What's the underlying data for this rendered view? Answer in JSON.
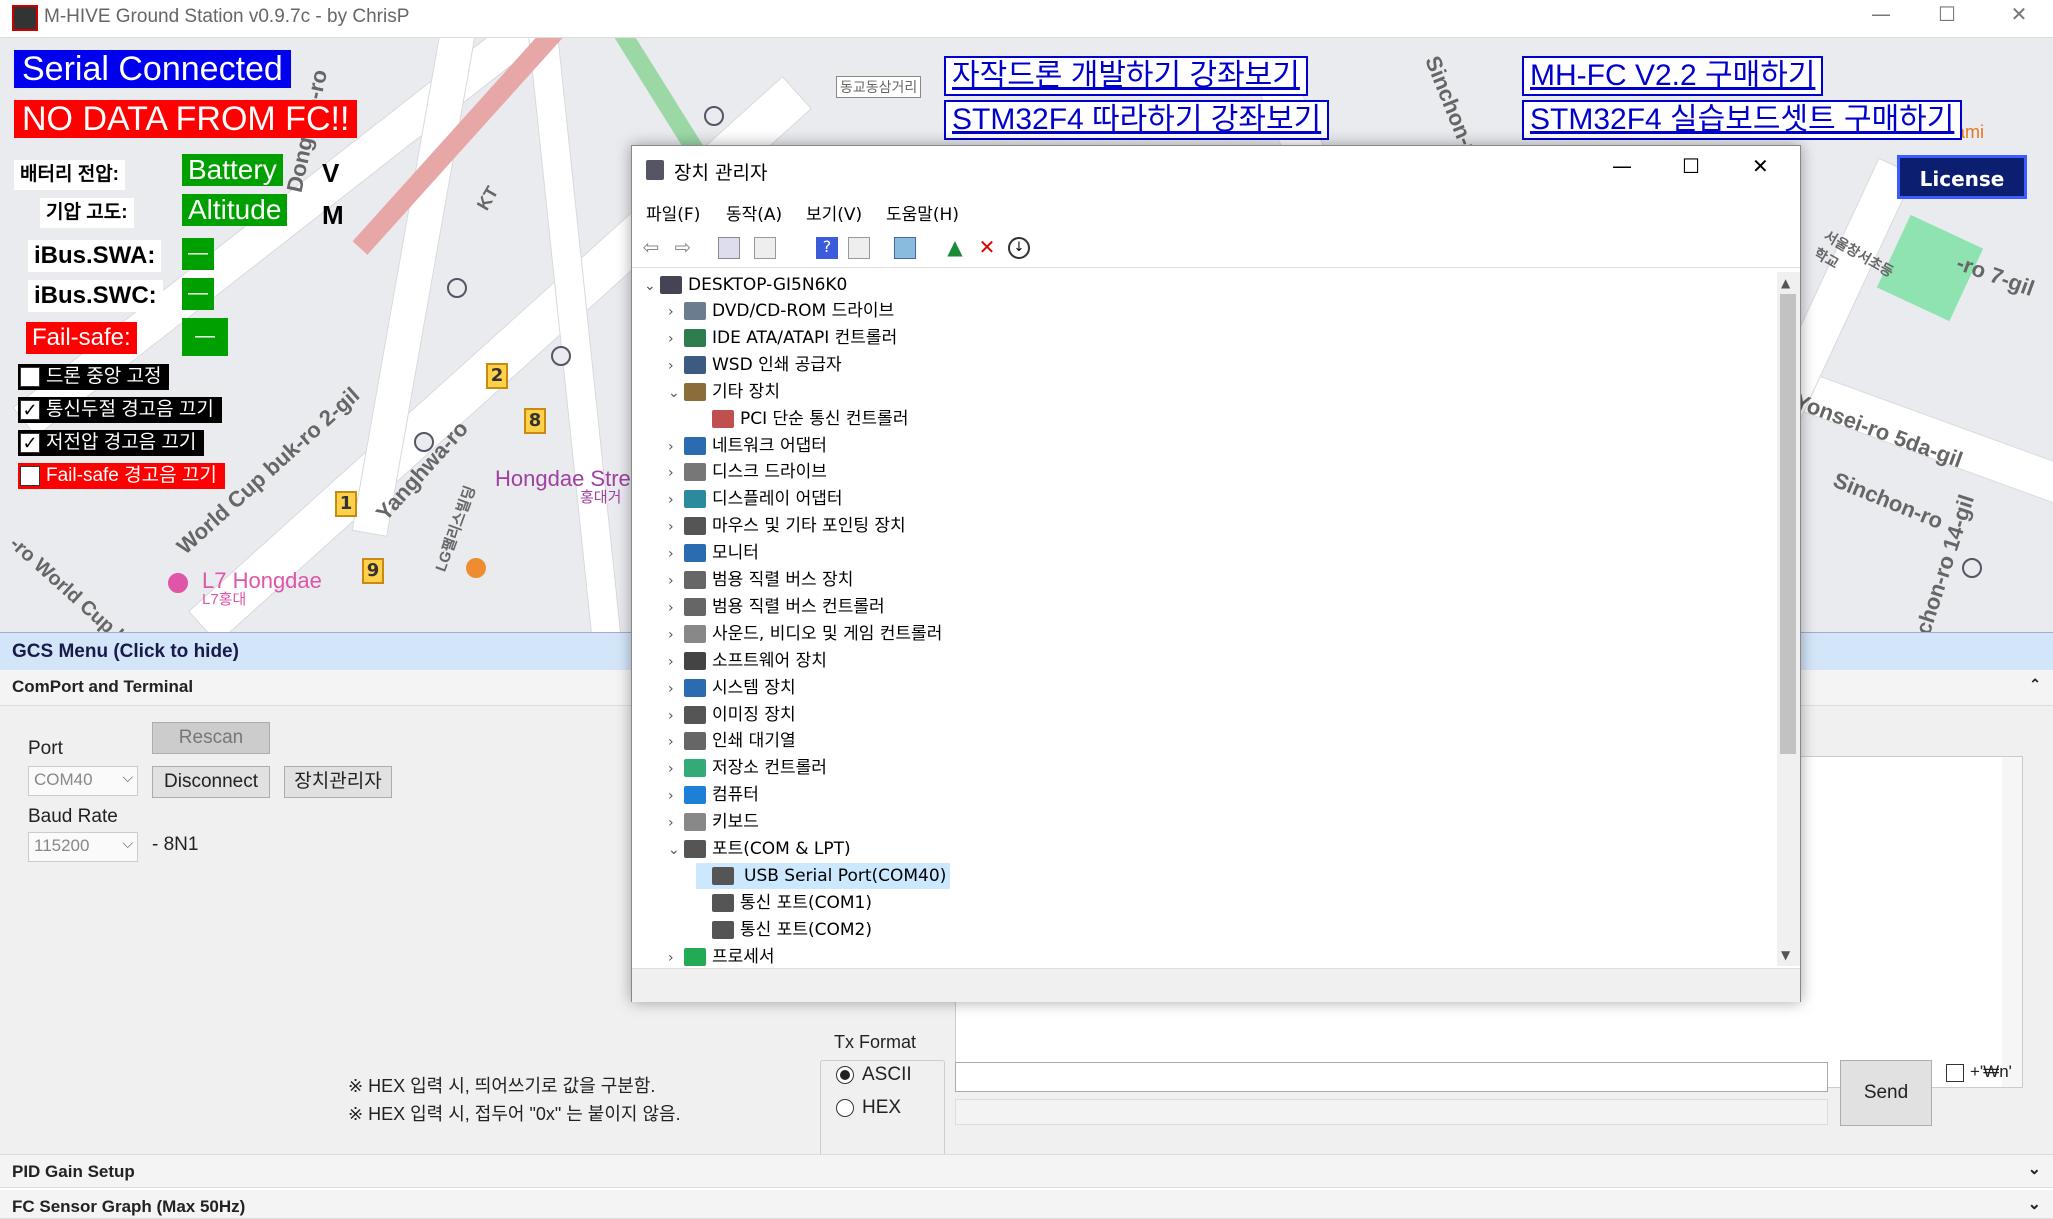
{
  "window": {
    "title": "M-HIVE Ground Station v0.9.7c - by ChrisP",
    "min": "—",
    "max": "☐",
    "close": "✕"
  },
  "map": {
    "labels": {
      "dongyo": "Donggyo-ro",
      "kt": "KT",
      "yanghwa": "Yanghwa-ro",
      "worldcup": "World Cup buk-ro 2-gil",
      "hongdae": "Hongdae Stree",
      "hongdae_kr": "홍대거",
      "l7": "L7 Hongdae",
      "l7_kr": "L7홍대",
      "lg": "LG팰리스빌딩",
      "sinchon": "Sinchon-ro",
      "yonsei": "Yonsei-ro 5da-gil",
      "sinchon14": "Sinchon-ro 14-gil",
      "ro7": "-ro 7-gil",
      "gosami": "Gosami",
      "seoulsch": "서울창서초등학교",
      "topsign": "동교동삼거리",
      "worldcupbuk": "-ro World Cup buk"
    },
    "pins": [
      "2",
      "8",
      "1",
      "9"
    ]
  },
  "hud": {
    "serial": "Serial Connected",
    "nodata": "NO DATA FROM FC!!",
    "battery_label": "배터리 전압:",
    "battery_value": "Battery",
    "battery_unit": "V",
    "altitude_label": "기압 고도:",
    "altitude_value": "Altitude",
    "altitude_unit": "M",
    "swa_label": "iBus.SWA:",
    "swa_value": "—",
    "swc_label": "iBus.SWC:",
    "swc_value": "—",
    "failsafe_label": "Fail-safe:",
    "failsafe_value": "—",
    "checkboxes": [
      {
        "label": "드론 중앙 고정",
        "checked": false
      },
      {
        "label": "통신두절 경고음 끄기",
        "checked": true
      },
      {
        "label": "저전압 경고음 끄기",
        "checked": true
      },
      {
        "label": "Fail-safe 경고음 끄기",
        "checked": false
      }
    ]
  },
  "links": {
    "course1": "자작드론 개발하기 강좌보기",
    "course2": "STM32F4 따라하기 강좌보기",
    "buy1": "MH-FC V2.2 구매하기",
    "buy2": "STM32F4 실습보드셋트 구매하기",
    "license": "License"
  },
  "gcs": {
    "menu": "GCS Menu (Click to hide)",
    "comport_section": "ComPort and Terminal",
    "port_label": "Port",
    "port_value": "COM40",
    "rescan": "Rescan",
    "disconnect": "Disconnect",
    "devmgr": "장치관리자",
    "baud_label": "Baud Rate",
    "baud_value": "115200",
    "baud_suffix": "- 8N1",
    "note1": "※ HEX 입력 시, 띄어쓰기로 값을 구분함.",
    "note2": "※ HEX 입력 시, 접두어 \"0x\" 는 붙이지 않음.",
    "tx_format": "Tx Format",
    "ascii": "ASCII",
    "hex": "HEX",
    "send": "Send",
    "newline": "+'₩n'",
    "pid_section": "PID Gain Setup",
    "sensor_section": "FC Sensor Graph (Max 50Hz)"
  },
  "devmgr": {
    "title": "장치 관리자",
    "menu": [
      "파일(F)",
      "동작(A)",
      "보기(V)",
      "도움말(H)"
    ],
    "root": "DESKTOP-GI5N6K0",
    "items": [
      {
        "label": "DVD/CD-ROM 드라이브",
        "expanded": false,
        "level": 1
      },
      {
        "label": "IDE ATA/ATAPI 컨트롤러",
        "expanded": false,
        "level": 1
      },
      {
        "label": "WSD 인쇄 공급자",
        "expanded": false,
        "level": 1
      },
      {
        "label": "기타 장치",
        "expanded": true,
        "level": 1
      },
      {
        "label": "PCI 단순 통신 컨트롤러",
        "expanded": null,
        "level": 2
      },
      {
        "label": "네트워크 어댑터",
        "expanded": false,
        "level": 1
      },
      {
        "label": "디스크 드라이브",
        "expanded": false,
        "level": 1
      },
      {
        "label": "디스플레이 어댑터",
        "expanded": false,
        "level": 1
      },
      {
        "label": "마우스 및 기타 포인팅 장치",
        "expanded": false,
        "level": 1
      },
      {
        "label": "모니터",
        "expanded": false,
        "level": 1
      },
      {
        "label": "범용 직렬 버스 장치",
        "expanded": false,
        "level": 1
      },
      {
        "label": "범용 직렬 버스 컨트롤러",
        "expanded": false,
        "level": 1
      },
      {
        "label": "사운드, 비디오 및 게임 컨트롤러",
        "expanded": false,
        "level": 1
      },
      {
        "label": "소프트웨어 장치",
        "expanded": false,
        "level": 1
      },
      {
        "label": "시스템 장치",
        "expanded": false,
        "level": 1
      },
      {
        "label": "이미징 장치",
        "expanded": false,
        "level": 1
      },
      {
        "label": "인쇄 대기열",
        "expanded": false,
        "level": 1
      },
      {
        "label": "저장소 컨트롤러",
        "expanded": false,
        "level": 1
      },
      {
        "label": "컴퓨터",
        "expanded": false,
        "level": 1
      },
      {
        "label": "키보드",
        "expanded": false,
        "level": 1
      },
      {
        "label": "포트(COM & LPT)",
        "expanded": true,
        "level": 1
      },
      {
        "label": "USB Serial Port(COM40)",
        "expanded": null,
        "level": 2,
        "selected": true
      },
      {
        "label": "통신 포트(COM1)",
        "expanded": null,
        "level": 2
      },
      {
        "label": "통신 포트(COM2)",
        "expanded": null,
        "level": 2
      },
      {
        "label": "프로세서",
        "expanded": false,
        "level": 1
      }
    ]
  }
}
